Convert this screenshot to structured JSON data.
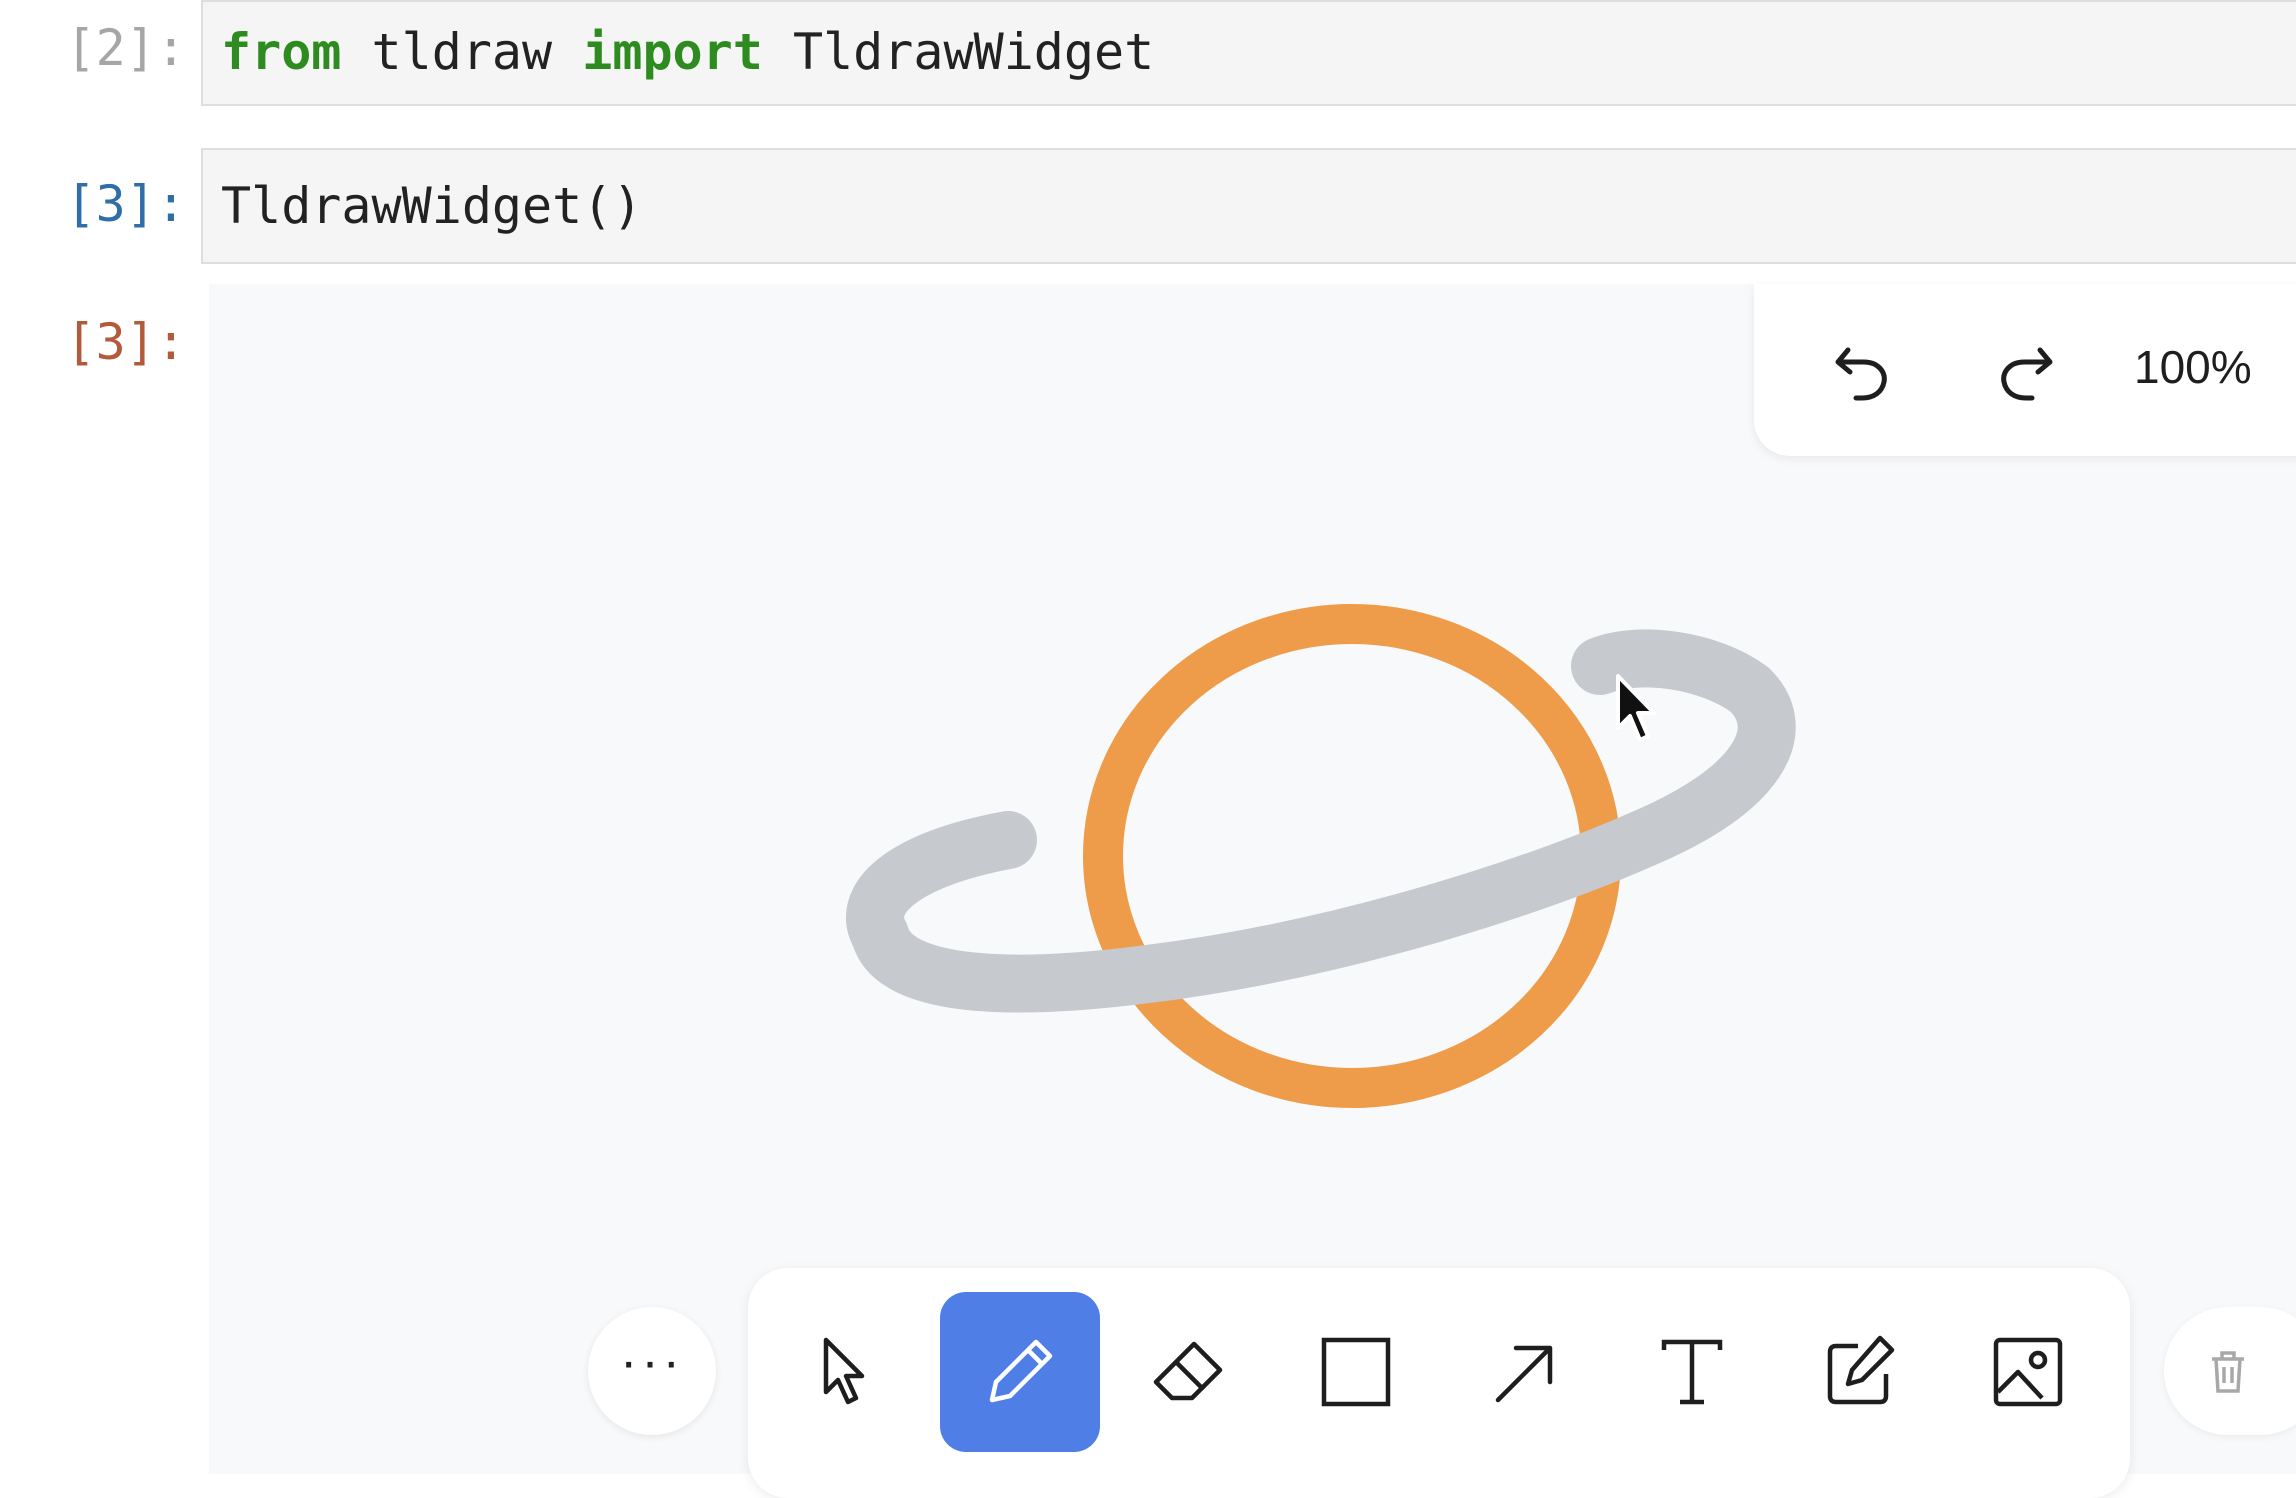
{
  "cells": [
    {
      "prompt": "[2]:",
      "code": {
        "kw1": "from",
        "mod": " tldraw ",
        "kw2": "import",
        "rest": " TldrawWidget"
      }
    },
    {
      "prompt": "[3]:",
      "code": "TldrawWidget()"
    }
  ],
  "output_prompt": "[3]:",
  "widget": {
    "zoom": "100%",
    "undo_icon": "undo-icon",
    "redo_icon": "redo-icon",
    "more_label": "···",
    "tools": [
      {
        "name": "select",
        "icon": "cursor-arrow-icon",
        "active": false
      },
      {
        "name": "draw",
        "icon": "pencil-icon",
        "active": true
      },
      {
        "name": "eraser",
        "icon": "eraser-icon",
        "active": false
      },
      {
        "name": "rectangle",
        "icon": "square-icon",
        "active": false
      },
      {
        "name": "arrow",
        "icon": "arrow-icon",
        "active": false
      },
      {
        "name": "text",
        "icon": "text-icon",
        "active": false
      },
      {
        "name": "note",
        "icon": "note-pencil-icon",
        "active": false
      },
      {
        "name": "image",
        "icon": "image-icon",
        "active": false
      }
    ],
    "delete_icon": "trash-icon",
    "colors": {
      "planet": "#ef9c4a",
      "ring": "#c6c9ce",
      "active_tool": "#4f7fe6"
    }
  }
}
